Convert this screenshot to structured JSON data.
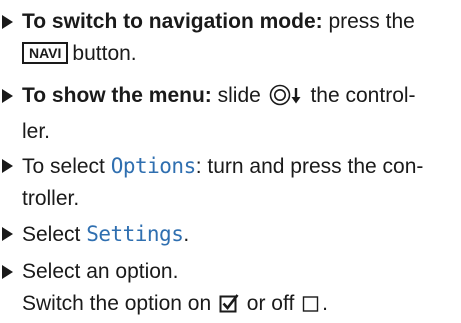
{
  "steps": [
    {
      "bold": "To switch to navigation mode:",
      "text_a": " press the",
      "key": "NAVI",
      "text_b": "button."
    },
    {
      "bold": "To show the menu:",
      "text_a": " slide ",
      "text_b": " the control-",
      "text_c": "ler."
    },
    {
      "text_a": "To select ",
      "highlight": "Options",
      "text_b": ": turn and press the con-",
      "text_c": "troller."
    },
    {
      "text_a": "Select ",
      "highlight": "Settings",
      "text_b": "."
    },
    {
      "text_a": "Select an option.",
      "text_b": "Switch the option on ",
      "text_c": " or off ",
      "text_d": "."
    }
  ],
  "icons": {
    "bullet": "triangle-bullet-icon",
    "controller": "controller-slide-down-icon",
    "checked": "checked-box-icon",
    "unchecked": "empty-box-icon"
  }
}
